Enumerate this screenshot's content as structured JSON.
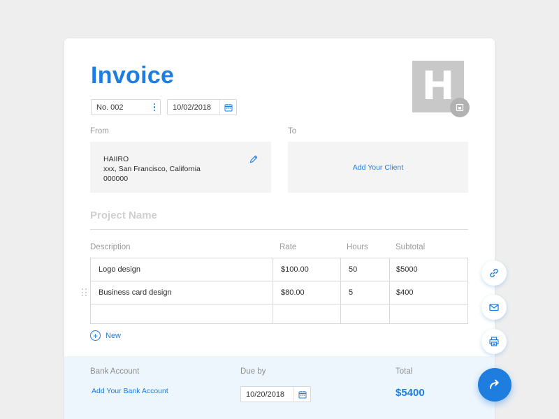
{
  "invoice": {
    "title": "Invoice",
    "number": "No. 002",
    "date": "10/02/2018",
    "logo_letter": "H"
  },
  "from": {
    "label": "From",
    "name": "HAIIRO",
    "address": "xxx, San Francisco, California",
    "zip": "000000"
  },
  "to": {
    "label": "To",
    "add_client": "Add Your Client"
  },
  "project": {
    "placeholder": "Project Name"
  },
  "table": {
    "headers": [
      "Description",
      "Rate",
      "Hours",
      "Subtotal"
    ],
    "rows": [
      [
        "Logo design",
        "$100.00",
        "50",
        "$5000"
      ],
      [
        "Business card design",
        "$80.00",
        "5",
        "$400"
      ]
    ],
    "new_label": "New"
  },
  "footer": {
    "bank_label": "Bank Account",
    "bank_link": "Add Your Bank Account",
    "due_label": "Due by",
    "due_date": "10/20/2018",
    "total_label": "Total",
    "total_value": "$5400"
  },
  "actions": [
    "link-icon",
    "mail-icon",
    "print-icon",
    "share-icon"
  ],
  "colors": {
    "accent": "#1d7ee0",
    "background": "#eeeeef",
    "footer": "#eef6fd"
  }
}
